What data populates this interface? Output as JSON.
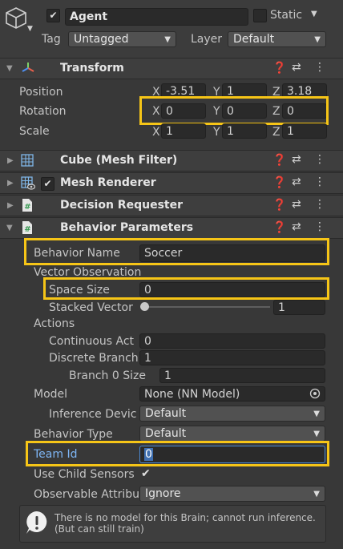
{
  "header": {
    "object_name": "Agent",
    "active_checked": "✔",
    "static_label": "Static",
    "tag_label": "Tag",
    "tag_value": "Untagged",
    "layer_label": "Layer",
    "layer_value": "Default"
  },
  "transform": {
    "title": "Transform",
    "position": {
      "label": "Position",
      "x": "-3.51",
      "y": "1",
      "z": "3.18"
    },
    "rotation": {
      "label": "Rotation",
      "x": "0",
      "y": "0",
      "z": "0"
    },
    "scale": {
      "label": "Scale",
      "x": "1",
      "y": "1",
      "z": "1"
    },
    "axes": {
      "x": "X",
      "y": "Y",
      "z": "Z"
    }
  },
  "components": {
    "mesh_filter": "Cube (Mesh Filter)",
    "mesh_renderer": "Mesh Renderer",
    "decision_requester": "Decision Requester",
    "behavior_parameters": "Behavior Parameters"
  },
  "behavior": {
    "behavior_name_label": "Behavior Name",
    "behavior_name_value": "Soccer",
    "vector_observation_label": "Vector Observation",
    "space_size_label": "Space Size",
    "space_size_value": "0",
    "stacked_vector_label": "Stacked Vector",
    "stacked_vector_value": "1",
    "stacked_vector_fraction": 0,
    "actions_label": "Actions",
    "continuous_label": "Continuous Act",
    "continuous_value": "0",
    "discrete_label": "Discrete Branch",
    "discrete_value": "1",
    "branch0_label": "Branch 0 Size",
    "branch0_value": "1",
    "model_label": "Model",
    "model_value": "None (NN Model)",
    "inference_label": "Inference Devic",
    "inference_value": "Default",
    "behavior_type_label": "Behavior Type",
    "behavior_type_value": "Default",
    "team_id_label": "Team Id",
    "team_id_value": "0",
    "child_sensors_label": "Use Child Sensors",
    "child_sensors_check": "✔",
    "observable_label": "Observable Attribu",
    "observable_value": "Ignore",
    "help_text": "There is no model for this Brain; cannot run inference. (But can still train)"
  },
  "colors": {
    "highlight": "#f6c517",
    "accent_blue": "#7eb6f5",
    "background": "#383838"
  }
}
